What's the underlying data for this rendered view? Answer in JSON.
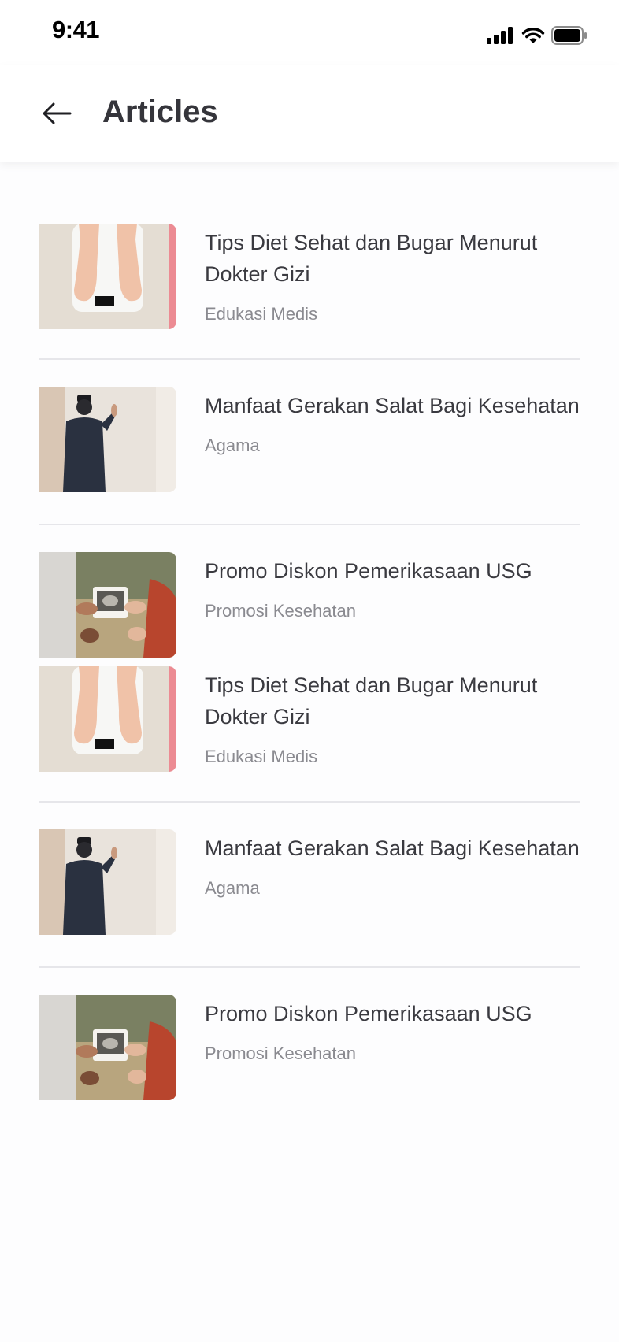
{
  "status_bar": {
    "time": "9:41",
    "icons": [
      "cellular-signal-icon",
      "wifi-icon",
      "battery-icon"
    ]
  },
  "header": {
    "back_icon": "arrow-left-icon",
    "title": "Articles"
  },
  "articles": [
    {
      "title": "Tips Diet Sehat dan Bugar Menurut Dokter Gizi",
      "category": "Edukasi Medis",
      "image": "scale-feet-image"
    },
    {
      "title": "Manfaat Gerakan Salat Bagi Kesehatan",
      "category": "Agama",
      "image": "man-praying-image"
    },
    {
      "title": "Promo Diskon Pemerikasaan USG",
      "category": "Promosi Kesehatan",
      "image": "ultrasound-photo-image"
    },
    {
      "title": "Tips Diet Sehat dan Bugar Menurut Dokter Gizi",
      "category": "Edukasi Medis",
      "image": "scale-feet-image"
    },
    {
      "title": "Manfaat Gerakan Salat Bagi Kesehatan",
      "category": "Agama",
      "image": "man-praying-image"
    },
    {
      "title": "Promo Diskon Pemerikasaan USG",
      "category": "Promosi Kesehatan",
      "image": "ultrasound-photo-image"
    }
  ],
  "colors": {
    "background": "#fdfdfe",
    "title_text": "#35353b",
    "category_text": "#8a8a90",
    "divider": "#e6e6ea"
  }
}
